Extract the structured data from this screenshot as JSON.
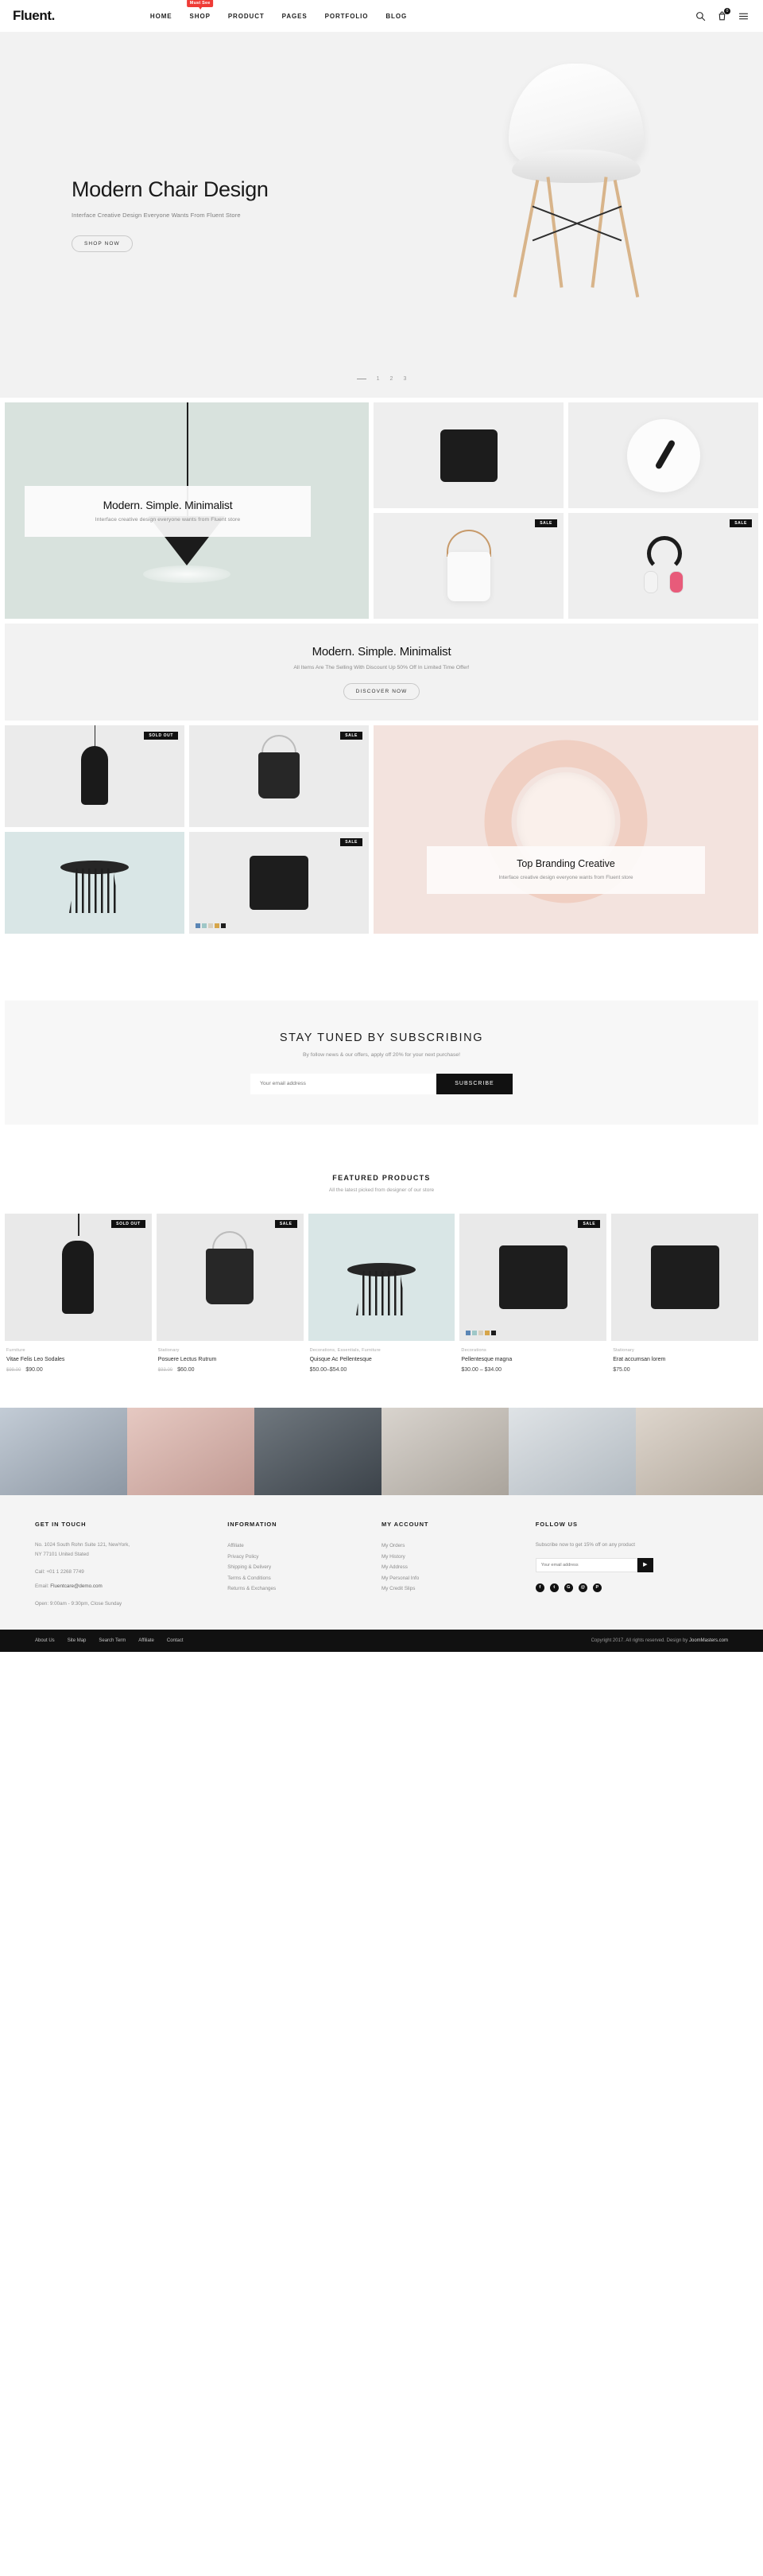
{
  "header": {
    "logo": "Fluent.",
    "nav": [
      {
        "label": "HOME",
        "badge": null
      },
      {
        "label": "SHOP",
        "badge": "Must See"
      },
      {
        "label": "PRODUCT",
        "badge": null
      },
      {
        "label": "PAGES",
        "badge": null
      },
      {
        "label": "PORTFOLIO",
        "badge": null
      },
      {
        "label": "BLOG",
        "badge": null
      }
    ],
    "icons": {
      "search": "search-icon",
      "cart": "cart-icon",
      "cart_count": "0",
      "menu": "hamburger-menu-icon"
    }
  },
  "hero": {
    "title": "Modern Chair Design",
    "subtitle": "Interface Creative Design Everyone Wants From Fluent Store",
    "cta": "SHOP NOW",
    "slides": [
      "1",
      "2",
      "3"
    ]
  },
  "category": {
    "overlay_title": "Modern. Simple. Minimalist",
    "overlay_sub": "Interface creative design everyone wants from Fluent store",
    "tiles": [
      {
        "name": "pillow-tile",
        "tag": null
      },
      {
        "name": "clock-tile",
        "tag": null
      },
      {
        "name": "bucket-tile",
        "tag": "SALE"
      },
      {
        "name": "headphone-tile",
        "tag": "SALE"
      }
    ]
  },
  "promo": {
    "title": "Modern. Simple. Minimalist",
    "subtitle": "All Items Are The Selling With Discount Up 50% Off In Limited Time Offer!",
    "cta": "DISCOVER NOW"
  },
  "showcase": {
    "tiles": [
      {
        "name": "lamp-tile",
        "tag": "SOLD OUT"
      },
      {
        "name": "bag-tile",
        "tag": "SALE"
      },
      {
        "name": "stool-tile",
        "tag": null
      },
      {
        "name": "cushion-tile",
        "tag": "SALE"
      }
    ],
    "swatches": [
      "#5b86b5",
      "#9ec7c7",
      "#d8d0c0",
      "#d6a54a",
      "#1d1d1d"
    ],
    "brand_title": "Top Branding Creative",
    "brand_sub": "Interface creative design everyone wants from Fluent store"
  },
  "newsletter": {
    "title": "STAY TUNED BY SUBSCRIBING",
    "subtitle": "By follow news & our offers, apply off 20% for your next purchase!",
    "placeholder": "Your email address",
    "button": "SUBSCRIBE"
  },
  "featured": {
    "title": "FEATURED PRODUCTS",
    "subtitle": "All the latest picked from designer of our store",
    "products": [
      {
        "category": "Furniture",
        "name": "Vitae Felis Leo Sodales",
        "old_price": "$99.00",
        "price": "$90.00",
        "tag": "SOLD OUT",
        "bg": "#e9e9e9",
        "art": "lamp",
        "swatches": []
      },
      {
        "category": "Stationary",
        "name": "Posuere Lectus Rutrum",
        "old_price": "$93.00",
        "price": "$60.00",
        "tag": "SALE",
        "bg": "#e9e9e9",
        "art": "bag",
        "swatches": []
      },
      {
        "category": "Decorations, Essentials, Furniture",
        "name": "Quisque Ac Pellentesque",
        "old_price": "",
        "price": "$50.00–$54.00",
        "tag": null,
        "bg": "#d9e6e6",
        "art": "stool",
        "swatches": [
          "#5b86b5",
          "#9ec7c7",
          "#d8d0c0",
          "#d6a54a",
          "#1d1d1d"
        ]
      },
      {
        "category": "Decorations",
        "name": "Pellentesque magna",
        "old_price": "",
        "price": "$30.00 – $34.00",
        "tag": "SALE",
        "bg": "#e9e9e9",
        "art": "cushion",
        "swatches": []
      },
      {
        "category": "Stationary",
        "name": "Erat accumsan lorem",
        "old_price": "",
        "price": "$75.00",
        "tag": null,
        "bg": "#e9e9e9",
        "art": "cushion",
        "swatches": []
      }
    ]
  },
  "instagram": {
    "cells": [
      "#b9c2cc",
      "#d8b6ae",
      "#5c6570",
      "#c9c3bd",
      "#cfd4d8",
      "#d6cfc8"
    ]
  },
  "footer": {
    "get_in_touch": {
      "heading": "GET IN TOUCH",
      "address_line1": "No. 1024 South Rohn Suite 121, NewYork,",
      "address_line2": "NY 77101 United Stated",
      "call_label": "Call:",
      "call_value": "+01 1 2268 7749",
      "email_label": "Email:",
      "email_value": "Fluentcare@demo.com",
      "hours": "Open: 9:00am - 9:30pm, Close Sunday"
    },
    "information": {
      "heading": "INFORMATION",
      "links": [
        "Affiliate",
        "Privacy Policy",
        "Shipping & Delivery",
        "Terms & Conditions",
        "Returns & Exchanges"
      ]
    },
    "account": {
      "heading": "MY ACCOUNT",
      "links": [
        "My Orders",
        "My History",
        "My Address",
        "My Personal Info",
        "My Credit Slips"
      ]
    },
    "follow": {
      "heading": "FOLLOW US",
      "text": "Subscribe now to get 15% off on any product",
      "placeholder": "Your email address",
      "socials": [
        "f",
        "t",
        "G",
        "@",
        "P"
      ]
    }
  },
  "bottom": {
    "links": [
      "About Us",
      "Site Map",
      "Search Term",
      "Affiliate",
      "Contact"
    ],
    "copyright_prefix": "Copyright 2017. All rights reserved. Design by",
    "copyright_brand": "JoomMasters.com"
  }
}
